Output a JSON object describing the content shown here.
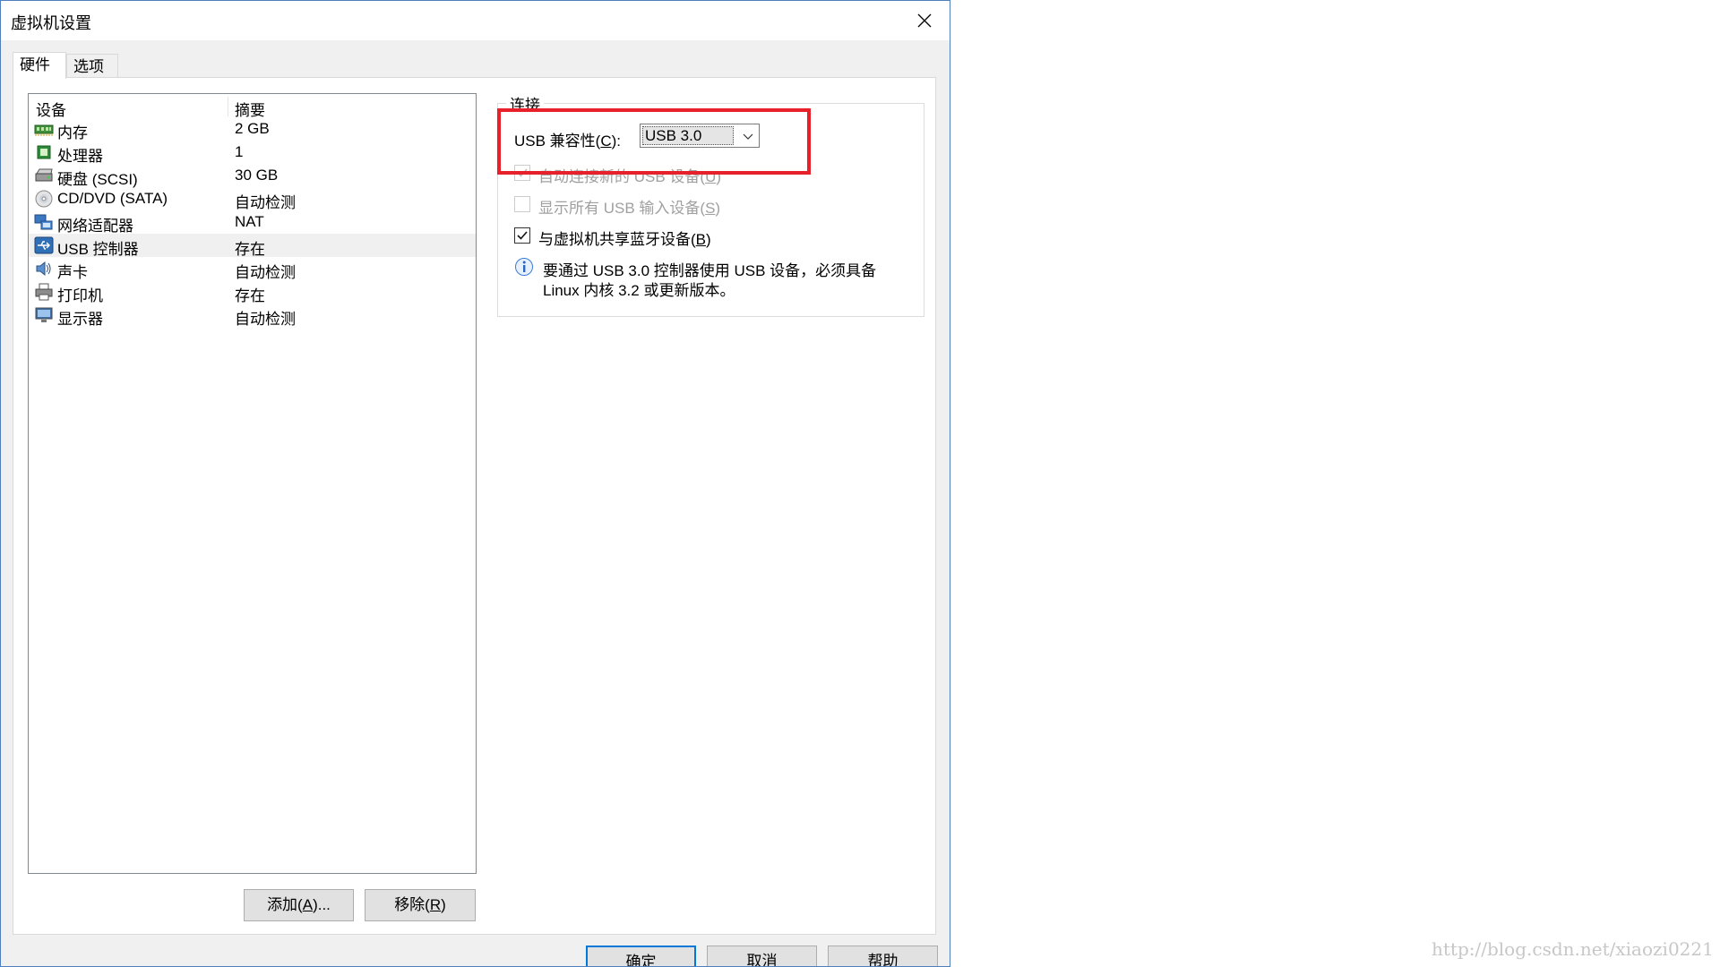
{
  "window": {
    "title": "虚拟机设置"
  },
  "tabs": [
    {
      "label": "硬件"
    },
    {
      "label": "选项"
    }
  ],
  "device_list": {
    "columns": {
      "device": "设备",
      "summary": "摘要"
    },
    "rows": [
      {
        "name": "内存",
        "summary": "2 GB",
        "icon": "memory-icon"
      },
      {
        "name": "处理器",
        "summary": "1",
        "icon": "processor-icon"
      },
      {
        "name": "硬盘 (SCSI)",
        "summary": "30 GB",
        "icon": "hard-disk-icon"
      },
      {
        "name": "CD/DVD (SATA)",
        "summary": "自动检测",
        "icon": "cd-dvd-icon"
      },
      {
        "name": "网络适配器",
        "summary": "NAT",
        "icon": "network-adapter-icon"
      },
      {
        "name": "USB 控制器",
        "summary": "存在",
        "icon": "usb-controller-icon",
        "selected": true
      },
      {
        "name": "声卡",
        "summary": "自动检测",
        "icon": "sound-card-icon"
      },
      {
        "name": "打印机",
        "summary": "存在",
        "icon": "printer-icon"
      },
      {
        "name": "显示器",
        "summary": "自动检测",
        "icon": "display-icon"
      }
    ]
  },
  "list_buttons": {
    "add": {
      "prefix": "添加(",
      "key": "A",
      "suffix": ")..."
    },
    "remove": {
      "prefix": "移除(",
      "key": "R",
      "suffix": ")"
    }
  },
  "connection": {
    "group_label": "连接",
    "usb_compat": {
      "prefix": "USB 兼容性(",
      "key": "C",
      "suffix": "):",
      "value": "USB 3.0"
    },
    "auto_connect": {
      "prefix": "自动连接新的 USB 设备(",
      "key": "U",
      "suffix": ")",
      "checked": true,
      "enabled": false
    },
    "show_all": {
      "prefix": "显示所有 USB 输入设备(",
      "key": "S",
      "suffix": ")",
      "checked": false,
      "enabled": false
    },
    "share_bt": {
      "prefix": "与虚拟机共享蓝牙设备(",
      "key": "B",
      "suffix": ")",
      "checked": true,
      "enabled": true
    },
    "info_line1": "要通过 USB 3.0 控制器使用 USB 设备，必须具备",
    "info_line2": "Linux 内核 3.2 或更新版本。"
  },
  "footer_buttons": {
    "ok": "确定",
    "cancel": "取消",
    "help": "帮助"
  },
  "annotation": {
    "color": "#e8202a"
  },
  "watermark": "http://blog.csdn.net/xiaozi0221"
}
